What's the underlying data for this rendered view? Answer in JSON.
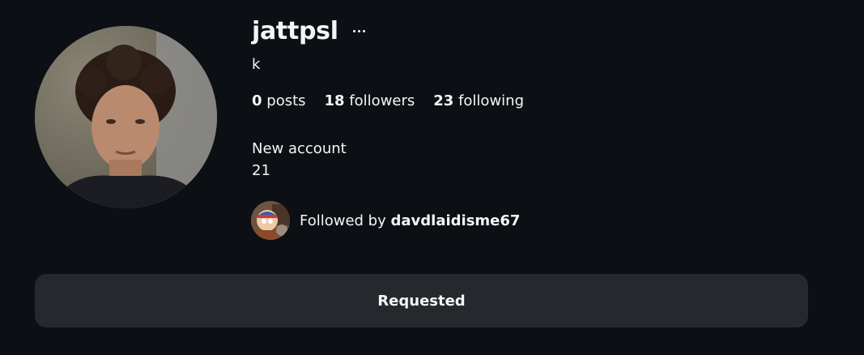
{
  "profile": {
    "username": "jattpsl",
    "full_name": "k",
    "more_icon": "more-horizontal-icon",
    "stats": {
      "posts_count": "0",
      "posts_label": "posts",
      "followers_count": "18",
      "followers_label": "followers",
      "following_count": "23",
      "following_label": "following"
    },
    "bio_lines": [
      "New account",
      "21"
    ],
    "followed_by": {
      "prefix": "Followed by",
      "username": "davdlaidisme67"
    },
    "action_button": {
      "label": "Requested"
    }
  },
  "colors": {
    "background": "#0c0f14",
    "text": "#f5f5f5",
    "button_bg": "#25282d"
  }
}
